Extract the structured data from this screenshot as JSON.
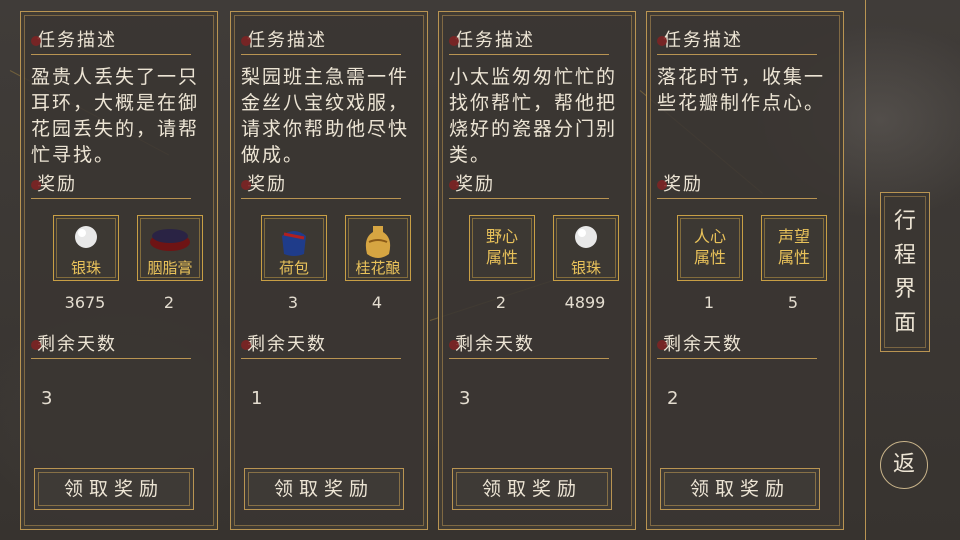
{
  "section_labels": {
    "task": "任务描述",
    "reward": "奖励",
    "days": "剩余天数"
  },
  "quests": [
    {
      "desc": "盈贵人丢失了一只耳环，大概是在御花园丢失的，请帮忙寻找。",
      "rewards": [
        {
          "name": "银珠",
          "count": "3675",
          "icon": "pearl-icon"
        },
        {
          "name": "胭脂膏",
          "count": "2",
          "icon": "rouge-box-icon"
        }
      ],
      "days": "3",
      "button": "领取奖励"
    },
    {
      "desc": "梨园班主急需一件金丝八宝纹戏服，请求你帮助他尽快做成。",
      "rewards": [
        {
          "name": "荷包",
          "count": "3",
          "icon": "pouch-icon"
        },
        {
          "name": "桂花酿",
          "count": "4",
          "icon": "wine-jar-icon"
        }
      ],
      "days": "1",
      "button": "领取奖励"
    },
    {
      "desc": "小太监匆匆忙忙的找你帮忙，帮他把烧好的瓷器分门别类。",
      "rewards": [
        {
          "name": "野心属性",
          "count": "2",
          "icon": "attribute-icon"
        },
        {
          "name": "银珠",
          "count": "4899",
          "icon": "pearl-icon"
        }
      ],
      "days": "3",
      "button": "领取奖励"
    },
    {
      "desc": "落花时节，收集一些花瓣制作点心。",
      "rewards": [
        {
          "name": "人心属性",
          "count": "1",
          "icon": "attribute-icon"
        },
        {
          "name": "声望属性",
          "count": "5",
          "icon": "attribute-icon"
        }
      ],
      "days": "2",
      "button": "领取奖励"
    }
  ],
  "side_tab": "行程界面",
  "back_button": "返",
  "colors": {
    "gold": "#b99452",
    "reward_text": "#e9c25a",
    "panel": "#3a3632"
  }
}
